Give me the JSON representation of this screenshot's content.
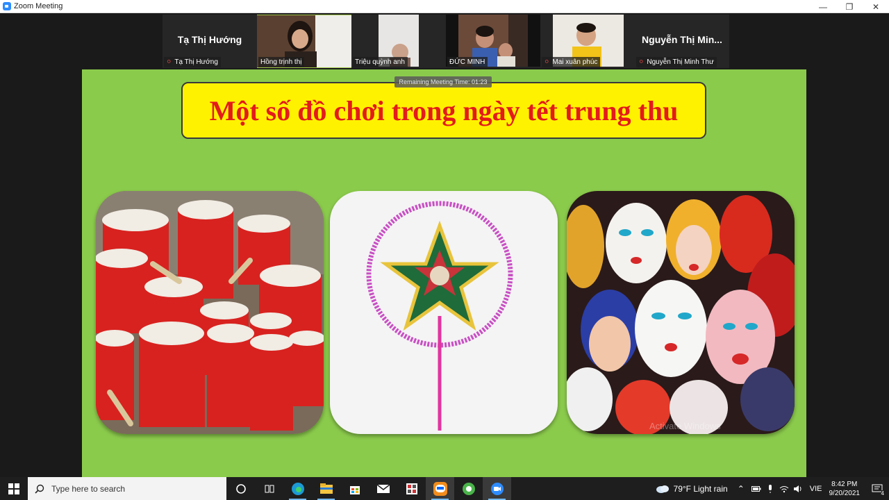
{
  "window": {
    "title": "Zoom Meeting"
  },
  "participants": [
    {
      "name": "Tạ Thị Hướng",
      "display_name": "Tạ Thị Hướng",
      "muted": true,
      "video": false
    },
    {
      "name": "Hồng trịnh thị",
      "muted": false,
      "video": true,
      "active": true
    },
    {
      "name": "Triệu quỳnh anh",
      "muted": false,
      "video": true
    },
    {
      "name": "ĐỨC MINH",
      "muted": false,
      "video": true
    },
    {
      "name": "Mai xuân phúc",
      "muted": true,
      "video": true
    },
    {
      "name": "Nguyễn Thị Minh Thư",
      "display_name": "Nguyễn Thị Min...",
      "muted": true,
      "video": false
    }
  ],
  "timer": {
    "text": "Remaining Meeting Time: 01:23"
  },
  "slide": {
    "title": "Một số đồ chơi trong ngày tết trung thu",
    "watermark": "Activate Windows"
  },
  "taskbar": {
    "search_placeholder": "Type here to search",
    "weather": "79°F  Light rain",
    "language": "VIE",
    "time": "8:42 PM",
    "date": "9/20/2021",
    "notification_count": "4"
  },
  "colors": {
    "slide_bg": "#8bcb4c",
    "banner_bg": "#fff200",
    "title_red": "#e31b1b",
    "zoom_blue": "#2d8cff"
  }
}
